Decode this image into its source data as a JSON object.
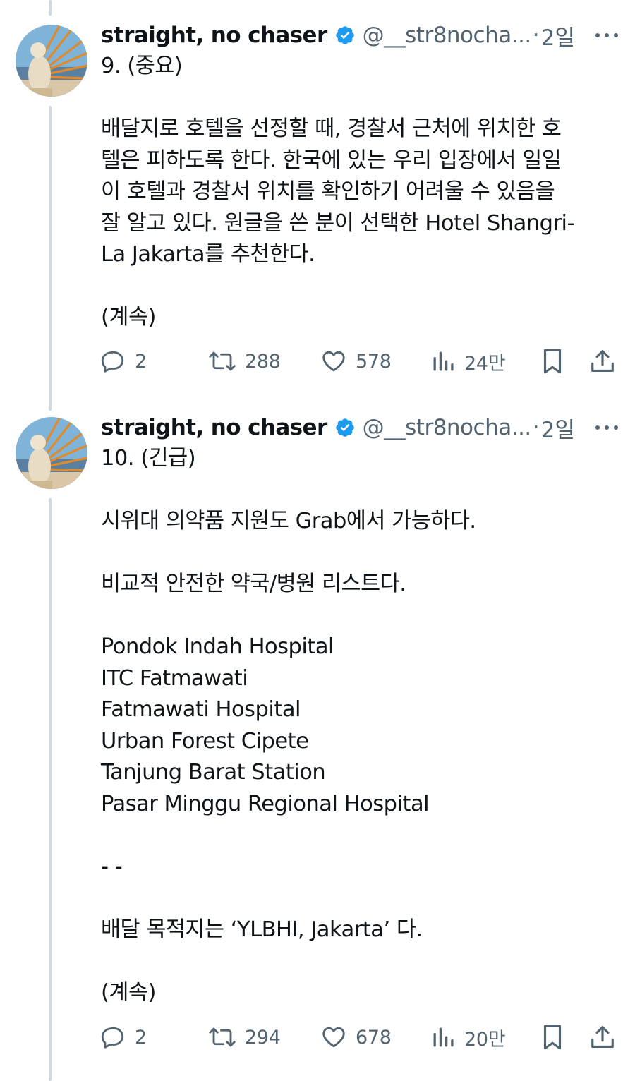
{
  "tweets": [
    {
      "author": {
        "name": "straight, no chaser",
        "handle": "@__str8nocha...",
        "time": "2일"
      },
      "lines": {
        "l1": "9. (중요)",
        "l2": "배달지로 호텔을 선정할 때, 경찰서 근처에 위치한 호",
        "l3": "텔은 피하도록 한다. 한국에 있는 우리 입장에서 일일",
        "l4": "이 호텔과 경찰서 위치를 확인하기 어려울 수 있음을",
        "l5": "잘 알고 있다. 원글을 쓴 분이 선택한 Hotel Shangri-",
        "l6": "La Jakarta를 추천한다.",
        "l7": "(계속)"
      },
      "stats": {
        "replies": "2",
        "retweets": "288",
        "likes": "578",
        "views": "24만"
      }
    },
    {
      "author": {
        "name": "straight, no chaser",
        "handle": "@__str8nocha...",
        "time": "2일"
      },
      "lines": {
        "l1": "10. (긴급)",
        "l2": "시위대 의약품 지원도 Grab에서 가능하다.",
        "l3": "비교적 안전한 약국/병원 리스트다.",
        "l4": "Pondok Indah Hospital",
        "l5": "ITC Fatmawati",
        "l6": "Fatmawati Hospital",
        "l7": "Urban Forest Cipete",
        "l8": "Tanjung Barat Station",
        "l9": "Pasar Minggu Regional Hospital",
        "l10": "- -",
        "l11": "배달 목적지는 ‘YLBHI, Jakarta’ 다.",
        "l12": "(계속)"
      },
      "stats": {
        "replies": "2",
        "retweets": "294",
        "likes": "678",
        "views": "20만"
      }
    }
  ],
  "colors": {
    "text": "#0f1419",
    "muted": "#536471",
    "verified": "#1d9bf0",
    "thread_line": "#cfd9de"
  },
  "icons": [
    "verified-badge-icon",
    "more-icon",
    "reply-icon",
    "retweet-icon",
    "like-icon",
    "views-icon",
    "bookmark-icon",
    "share-icon"
  ]
}
